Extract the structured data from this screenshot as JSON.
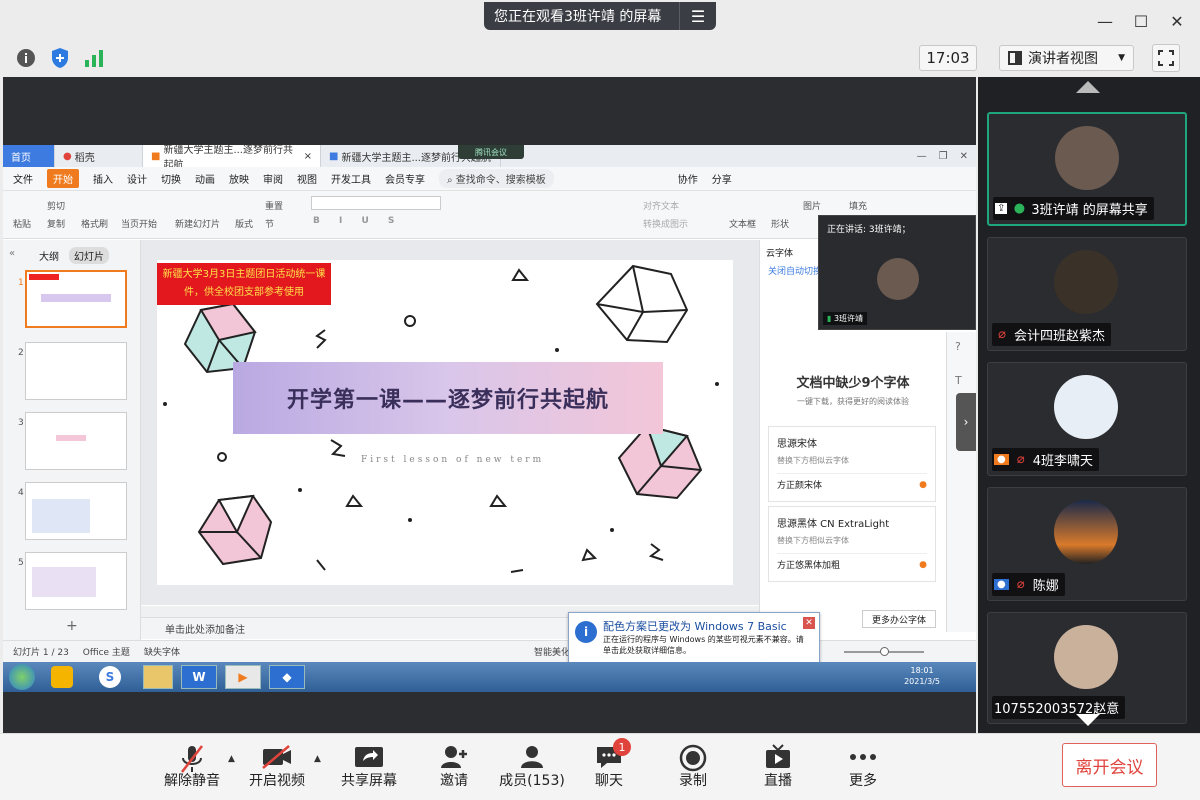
{
  "share_banner": {
    "text": "您正在观看3班许靖 的屏幕",
    "menu_icon": "list-icon"
  },
  "window": {
    "minimize": "—",
    "maximize": "☐",
    "close": "✕"
  },
  "top": {
    "clock": "17:03",
    "view_mode": "演讲者视图"
  },
  "wps": {
    "tabs": [
      "首页",
      "稻壳",
      "新疆大学主题主...逐梦前行共起航",
      "新疆大学主题主...逐梦前行共起航"
    ],
    "meeting_tag": "腾讯会议",
    "menu": [
      "文件",
      "开始",
      "插入",
      "设计",
      "切换",
      "动画",
      "放映",
      "审阅",
      "视图",
      "开发工具",
      "会员专享"
    ],
    "search": "查找命令、搜索模板",
    "menu_right": [
      "协作",
      "分享"
    ],
    "ribbon": [
      "粘贴",
      "剪切",
      "复制",
      "格式刷",
      "当页开始",
      "新建幻灯片",
      "版式",
      "重置",
      "节",
      "文本框",
      "形状",
      "图片",
      "填充",
      "对齐文本",
      "转换成图示"
    ],
    "panel_tabs": [
      "大纲",
      "幻灯片"
    ],
    "slide_numbers": [
      "1",
      "2",
      "3",
      "4",
      "5"
    ],
    "slide": {
      "banner": "新疆大学3月3日主题团日活动统一课件，供全校团支部参考使用",
      "title": "开学第一课——逐梦前行共起航",
      "subtitle": "First lesson of new term"
    },
    "notes_placeholder": "单击此处添加备注",
    "status": {
      "page": "幻灯片 1 / 23",
      "theme": "Office 主题",
      "missing": "缺失字体",
      "beautify": "智能美化"
    },
    "font_panel": {
      "header": "云字体",
      "close_auto": "关闭自动切换",
      "title": "文档中缺少9个字体",
      "subtitle": "一键下载，获得更好的阅读体验",
      "items": [
        {
          "name": "思源宋体",
          "hint": "替换下方相似云字体",
          "replace": "方正颜宋体"
        },
        {
          "name": "思源黑体 CN ExtraLight",
          "hint": "替换下方相似云字体",
          "replace": "方正悠黑体加粗"
        }
      ],
      "more": "更多办公字体"
    },
    "popup": {
      "title": "配色方案已更改为 Windows 7 Basic",
      "body": "正在运行的程序与 Windows 的某些可视元素不兼容。请单击此处获取详细信息。"
    },
    "taskbar_clock": {
      "time": "18:01",
      "date": "2021/3/5"
    },
    "speaker": {
      "label": "正在讲话: 3班许靖；",
      "name": "3班许靖"
    }
  },
  "participants": [
    {
      "name": "3班许靖 的屏幕共享",
      "avatar_color": "#6b5a50",
      "active": true
    },
    {
      "name": "会计四班赵紫杰",
      "avatar_color": "#3a3128",
      "active": false
    },
    {
      "name": "4班李啸天",
      "avatar_color": "#e8eef5",
      "active": false
    },
    {
      "name": "陈娜",
      "avatar_color": "#d97a2b",
      "active": false
    },
    {
      "name": "107552003572赵意",
      "avatar_color": "#c9b19c",
      "active": false
    }
  ],
  "toolbar": {
    "mute": "解除静音",
    "video": "开启视频",
    "share": "共享屏幕",
    "invite": "邀请",
    "members": "成员(153)",
    "chat": "聊天",
    "chat_badge": "1",
    "record": "录制",
    "live": "直播",
    "more": "更多",
    "leave": "离开会议"
  },
  "colors": {
    "accent": "#1fa67a",
    "danger": "#e0433b",
    "wps_orange": "#f07b1e",
    "wps_blue": "#3d7be0"
  }
}
